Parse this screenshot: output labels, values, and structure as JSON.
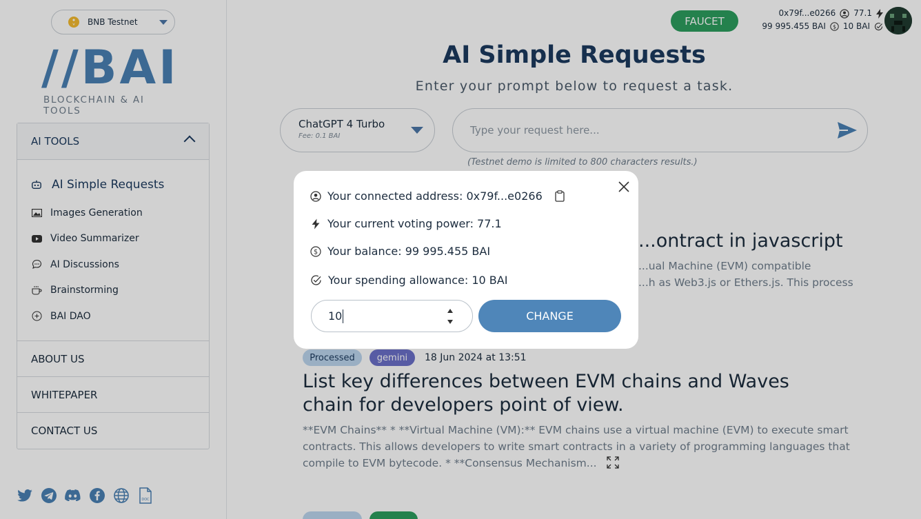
{
  "network": {
    "name": "BNB Testnet"
  },
  "logo": {
    "mark": "//BAI",
    "tagline": "BLOCKCHAIN & AI TOOLS"
  },
  "menu": {
    "header": "AI TOOLS",
    "items": [
      {
        "label": "AI Simple Requests",
        "icon": "robot-icon"
      },
      {
        "label": "Images Generation",
        "icon": "image-icon"
      },
      {
        "label": "Video Summarizer",
        "icon": "youtube-icon"
      },
      {
        "label": "AI Discussions",
        "icon": "chat-icon"
      },
      {
        "label": "Brainstorming",
        "icon": "coffee-icon"
      },
      {
        "label": "BAI DAO",
        "icon": "plus-circle-icon"
      }
    ],
    "links": [
      "ABOUT US",
      "WHITEPAPER",
      "CONTACT US"
    ]
  },
  "header": {
    "faucet": "FAUCET",
    "address": "0x79f...e0266",
    "voting_power": "77.1",
    "balance": "99 995.455 BAI",
    "allowance": "10 BAI"
  },
  "page": {
    "title": "AI Simple Requests",
    "subtitle": "Enter your prompt below to request a task.",
    "model": {
      "name": "ChatGPT 4 Turbo",
      "fee": "Fee: 0.1 BAI"
    },
    "placeholder": "Type your request here...",
    "limit_note": "(Testnet demo is limited to 800 characters results.)"
  },
  "cards": [
    {
      "title": "...ontract in javascript",
      "text1": "...ual Machine (EVM) compatible",
      "text2": "...h as Web3.js or Ethers.js. This process"
    },
    {
      "status": "Processed",
      "model": "gemini",
      "date": "18 Jun 2024 at 13:51",
      "title1": "List key differences between EVM chains and Waves",
      "title2": "chain for developers point of view.",
      "text1": "**EVM Chains** * **Virtual Machine (VM):** EVM chains use a virtual machine (EVM) to execute smart",
      "text2": "contracts. This allows developers to write smart contracts in a variety of programming languages that",
      "text3": "compile to EVM bytecode. * **Consensus Mechanism..."
    }
  ],
  "modal": {
    "address_label": "Your connected address: 0x79f...e0266",
    "voting_label": "Your current voting power: 77.1",
    "balance_label": "Your balance: 99 995.455 BAI",
    "allowance_label": "Your spending allowance: 10 BAI",
    "allowance_value": "10",
    "change_button": "CHANGE"
  },
  "colors": {
    "accent": "#4f86b9",
    "faucet": "#2d9e5f",
    "gemini": "#6b6fc9",
    "heading": "#1c3a5e"
  }
}
